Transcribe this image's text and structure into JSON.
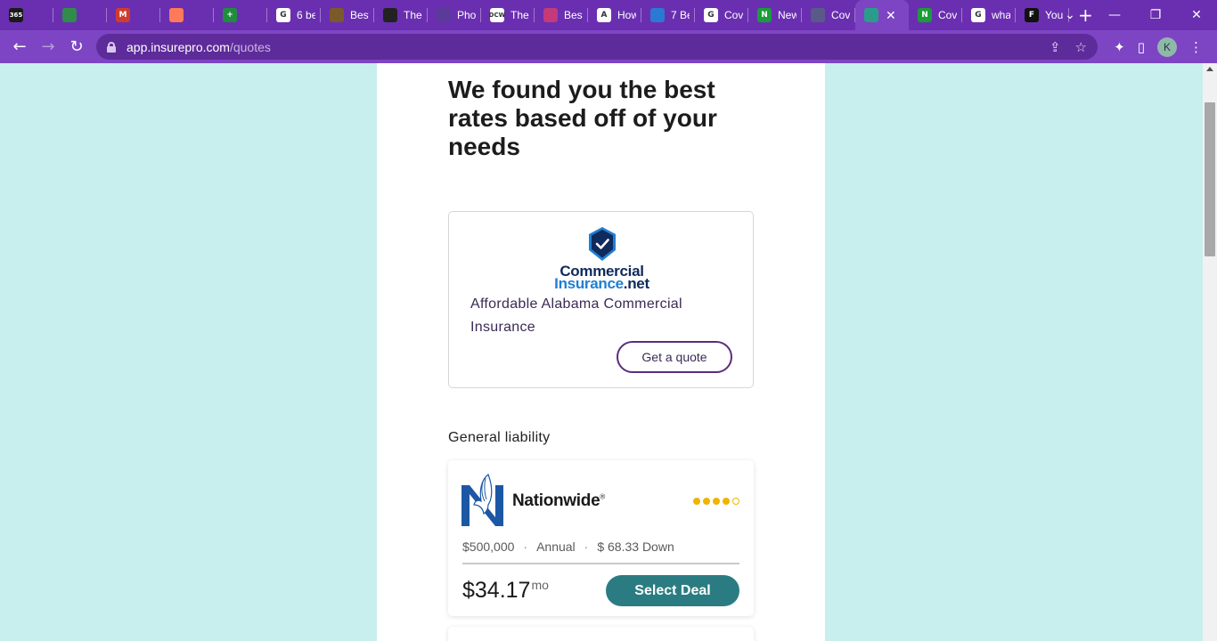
{
  "browser": {
    "tabs": [
      {
        "icon": "office365-icon",
        "title": "",
        "badge": "365",
        "color": "#1a1a1a"
      },
      {
        "icon": "google-drive-icon",
        "title": "",
        "badge": "",
        "color": "#2f8c4b"
      },
      {
        "icon": "gmail-icon",
        "title": "",
        "badge": "M",
        "color": "#d13b2e"
      },
      {
        "icon": "hubspot-icon",
        "title": "",
        "badge": "",
        "color": "#ff7a59"
      },
      {
        "icon": "google-sheets-icon",
        "title": "",
        "badge": "+",
        "color": "#1e8e3e"
      },
      {
        "icon": "google-icon",
        "title": "6 be",
        "badge": "G",
        "color": "#ffffff"
      },
      {
        "icon": "site-icon",
        "title": "Best",
        "badge": "",
        "color": "#7a5a2a"
      },
      {
        "icon": "site-icon",
        "title": "The",
        "badge": "",
        "color": "#222222"
      },
      {
        "icon": "site-icon",
        "title": "Pho",
        "badge": "",
        "color": "#5b3a9a"
      },
      {
        "icon": "dcw-icon",
        "title": "The",
        "badge": "DCW",
        "color": "#ffffff"
      },
      {
        "icon": "site-icon",
        "title": "Best",
        "badge": "",
        "color": "#c43a7a"
      },
      {
        "icon": "site-icon",
        "title": "How",
        "badge": "A",
        "color": "#ffffff"
      },
      {
        "icon": "site-icon",
        "title": "7 Be",
        "badge": "",
        "color": "#2a7ad4"
      },
      {
        "icon": "google-icon",
        "title": "Cov",
        "badge": "G",
        "color": "#ffffff"
      },
      {
        "icon": "nerdwallet-icon",
        "title": "New",
        "badge": "N",
        "color": "#1a9c3a"
      },
      {
        "icon": "site-icon",
        "title": "Cov",
        "badge": "",
        "color": "#5a5a8a"
      },
      {
        "icon": "insurepro-icon",
        "title": "",
        "badge": "",
        "color": "#2b9c8a"
      },
      {
        "icon": "nerdwallet-icon",
        "title": "Cov",
        "badge": "N",
        "color": "#1a9c3a"
      },
      {
        "icon": "google-icon",
        "title": "wha",
        "badge": "G",
        "color": "#ffffff"
      },
      {
        "icon": "forbes-icon",
        "title": "You",
        "badge": "F",
        "color": "#111111"
      }
    ],
    "active_tab_index": 16,
    "url_host": "app.insurepro.com",
    "url_path": "/quotes",
    "profile_initial": "K"
  },
  "page": {
    "headline": "We found you the best rates based off of your needs",
    "featured": {
      "logo_line1": "Commercial",
      "logo_line2_a": "Insurance",
      "logo_line2_b": ".net",
      "title": "Affordable Alabama Commercial Insurance",
      "button_label": "Get a quote"
    },
    "section_label": "General liability",
    "deal": {
      "carrier": "Nationwide",
      "carrier_mark": "®",
      "rating": 4,
      "rating_max": 5,
      "coverage": "$500,000",
      "term": "Annual",
      "down_payment": "$ 68.33 Down",
      "price": "$34.17",
      "price_unit": "mo",
      "button_label": "Select Deal"
    }
  }
}
